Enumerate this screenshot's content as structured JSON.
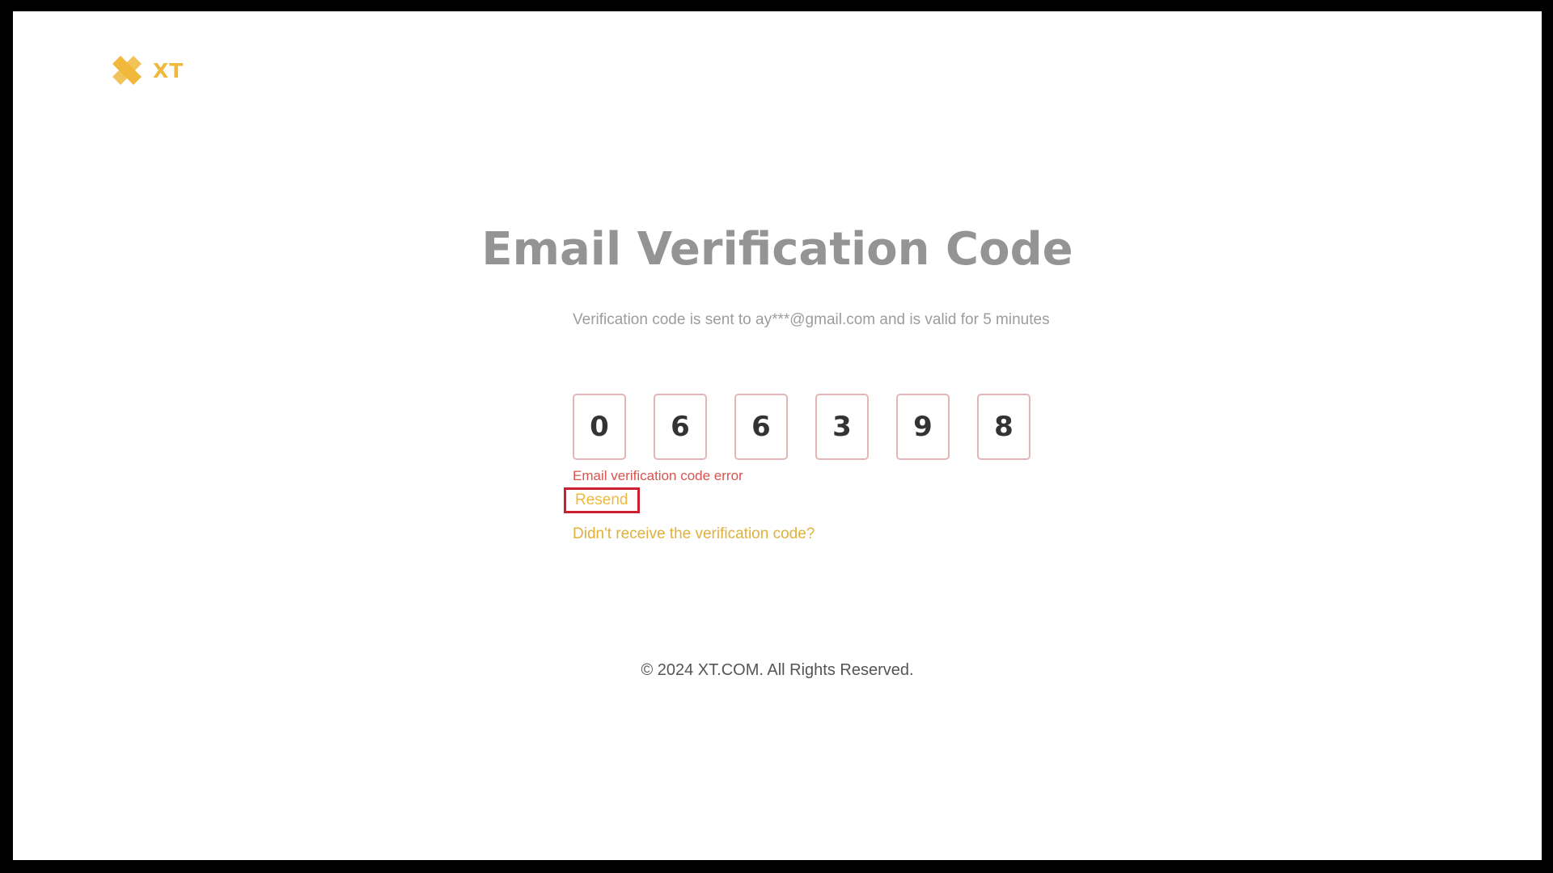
{
  "brand": {
    "name": "XT",
    "color": "#f0b93c",
    "icon": "xt-logo-icon"
  },
  "page": {
    "title": "Email Verification Code",
    "description": "Verification code is sent to ay***@gmail.com and is valid for 5 minutes"
  },
  "code": {
    "digits": [
      "0",
      "6",
      "6",
      "3",
      "9",
      "8"
    ]
  },
  "error": {
    "message": "Email verification code error",
    "color": "#d9534f"
  },
  "actions": {
    "resend_label": "Resend",
    "help_label": "Didn't receive the verification code?"
  },
  "footer": {
    "copyright": "© 2024 XT.COM. All Rights Reserved."
  }
}
